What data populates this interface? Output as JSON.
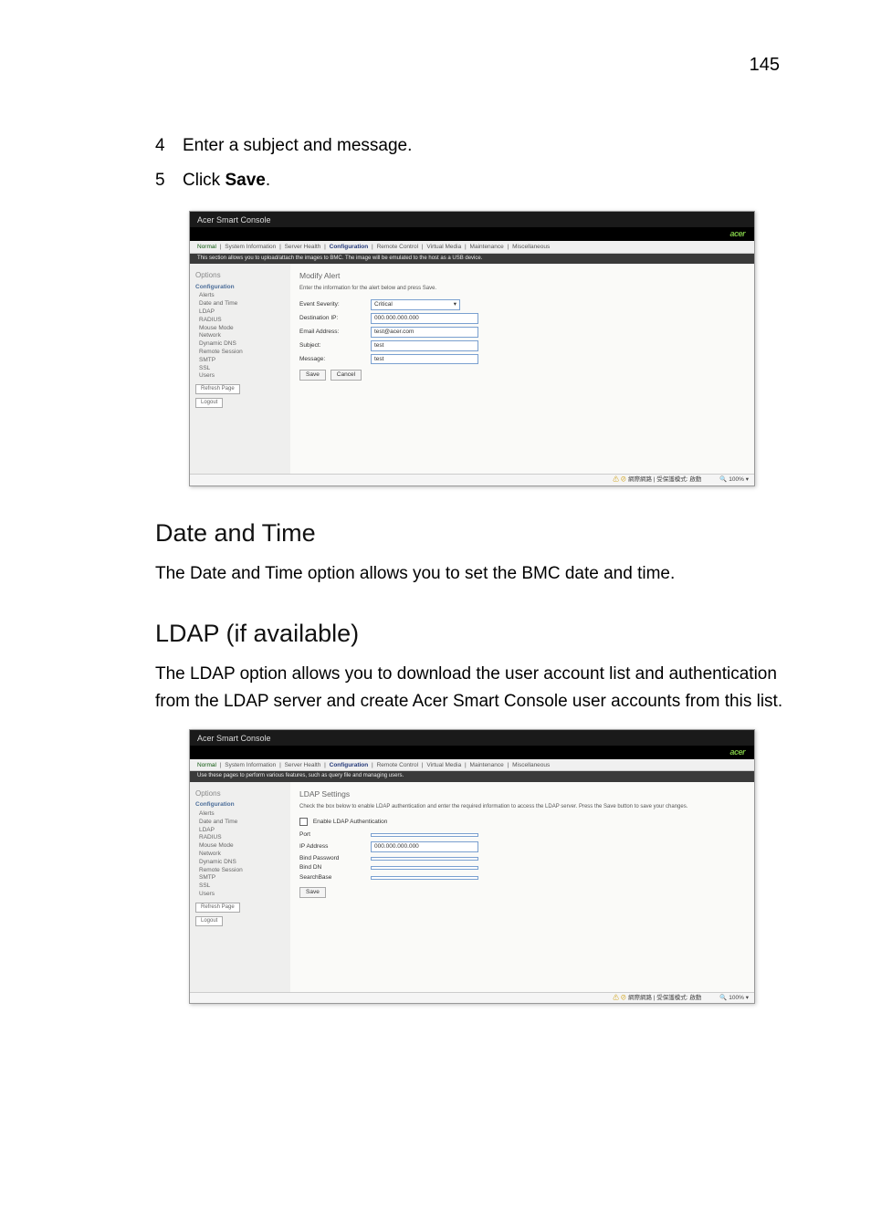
{
  "page_number": "145",
  "steps": [
    {
      "num": "4",
      "text": "Enter a subject and message."
    },
    {
      "num": "5",
      "text_pre": "Click ",
      "text_bold": "Save",
      "text_post": "."
    }
  ],
  "sections": {
    "date_time": {
      "title": "Date and Time",
      "body": "The Date and Time option allows you to set the BMC date and time."
    },
    "ldap": {
      "title": "LDAP (if available)",
      "body": "The LDAP option allows you to download the user account list and authentication from the LDAP server and create Acer Smart Console user accounts from this list."
    }
  },
  "screenshot_common": {
    "app_title": "Acer Smart Console",
    "logo": "acer",
    "tabs": [
      "Normal",
      "System Information",
      "Server Health",
      "Configuration",
      "Remote Control",
      "Virtual Media",
      "Maintenance",
      "Miscellaneous"
    ],
    "sidebar_title": "Options",
    "sidebar_head": "Configuration",
    "sidebar_items": [
      "Alerts",
      "Date and Time",
      "LDAP",
      "RADIUS",
      "Mouse Mode",
      "Network",
      "Dynamic DNS",
      "Remote Session",
      "SMTP",
      "SSL",
      "Users"
    ],
    "refresh_label": "Refresh Page",
    "logout_label": "Logout",
    "status_text": "網際網路 | 受保護模式: 啟動",
    "zoom_text": "100%"
  },
  "shot1": {
    "subbar": "This section allows you to upload/attach the images to BMC. The image will be emulated to the host as a USB device.",
    "main_title": "Modify Alert",
    "main_desc": "Enter the information for the alert below and press Save.",
    "fields": [
      {
        "label": "Event Severity:",
        "value": "Critical",
        "type": "select"
      },
      {
        "label": "Destination IP:",
        "value": "000.000.000.000",
        "type": "text"
      },
      {
        "label": "Email Address:",
        "value": "test@acer.com",
        "type": "text"
      },
      {
        "label": "Subject:",
        "value": "test",
        "type": "text"
      },
      {
        "label": "Message:",
        "value": "test",
        "type": "text"
      }
    ],
    "save_label": "Save",
    "cancel_label": "Cancel"
  },
  "shot2": {
    "subbar": "Use these pages to perform various features, such as query file and managing users.",
    "main_title": "LDAP Settings",
    "main_desc": "Check the box below to enable LDAP authentication and enter the required information to access the LDAP server. Press the Save button to save your changes.",
    "enable_label": "Enable LDAP Authentication",
    "fields": [
      {
        "label": "Port",
        "value": ""
      },
      {
        "label": "IP Address",
        "value": "000.000.000.000"
      },
      {
        "label": "Bind Password",
        "value": ""
      },
      {
        "label": "Bind DN",
        "value": ""
      },
      {
        "label": "SearchBase",
        "value": ""
      }
    ],
    "save_label": "Save"
  }
}
